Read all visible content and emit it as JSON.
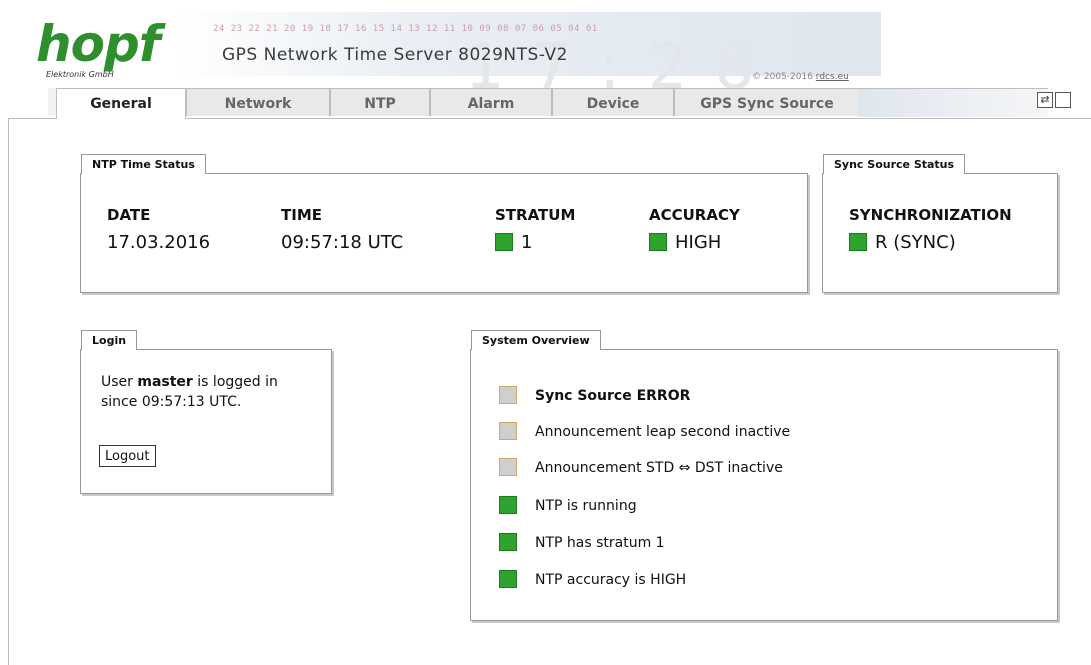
{
  "header": {
    "logo_text": "hopf",
    "logo_sub": "Elektronik   GmbH",
    "banner_numbers": "24 23 22 21 20 19 18 17 16 15 14 13 12 11 10 09 08 07 06 05 04 01",
    "title": "GPS Network Time Server 8029NTS-V2",
    "copyright": "© 2005-2016",
    "copyright_link": "rdcs.eu"
  },
  "tabs": [
    {
      "label": "General",
      "active": true
    },
    {
      "label": "Network",
      "active": false
    },
    {
      "label": "NTP",
      "active": false
    },
    {
      "label": "Alarm",
      "active": false
    },
    {
      "label": "Device",
      "active": false
    },
    {
      "label": "GPS Sync Source",
      "active": false
    }
  ],
  "toolbar_icons": [
    "refresh-icon",
    "window-icon"
  ],
  "ntp_status": {
    "heading": "NTP Time Status",
    "date_label": "DATE",
    "date_value": "17.03.2016",
    "time_label": "TIME",
    "time_value": "09:57:18 UTC",
    "stratum_label": "STRATUM",
    "stratum_value": "1",
    "accuracy_label": "ACCURACY",
    "accuracy_value": "HIGH"
  },
  "sync_status": {
    "heading": "Sync Source Status",
    "sync_label": "SYNCHRONIZATION",
    "sync_value": "R (SYNC)"
  },
  "login": {
    "heading": "Login",
    "text_prefix": "User ",
    "user": "master",
    "text_suffix": " is logged in",
    "since_text": "since 09:57:13 UTC.",
    "logout_label": "Logout"
  },
  "overview": {
    "heading": "System Overview",
    "items": [
      {
        "text": "Sync Source ERROR",
        "status": "grey",
        "bold": true
      },
      {
        "text": "Announcement leap second inactive",
        "status": "grey",
        "bold": false
      },
      {
        "text": "Announcement STD ⇔ DST inactive",
        "status": "grey",
        "bold": false
      },
      {
        "text": "NTP is running",
        "status": "green",
        "bold": false
      },
      {
        "text": "NTP has stratum 1",
        "status": "green",
        "bold": false
      },
      {
        "text": "NTP accuracy is HIGH",
        "status": "green",
        "bold": false
      }
    ]
  },
  "colors": {
    "ok": "#2ea32e",
    "inactive": "#cfcfcf",
    "logo": "#2f8f2f"
  }
}
